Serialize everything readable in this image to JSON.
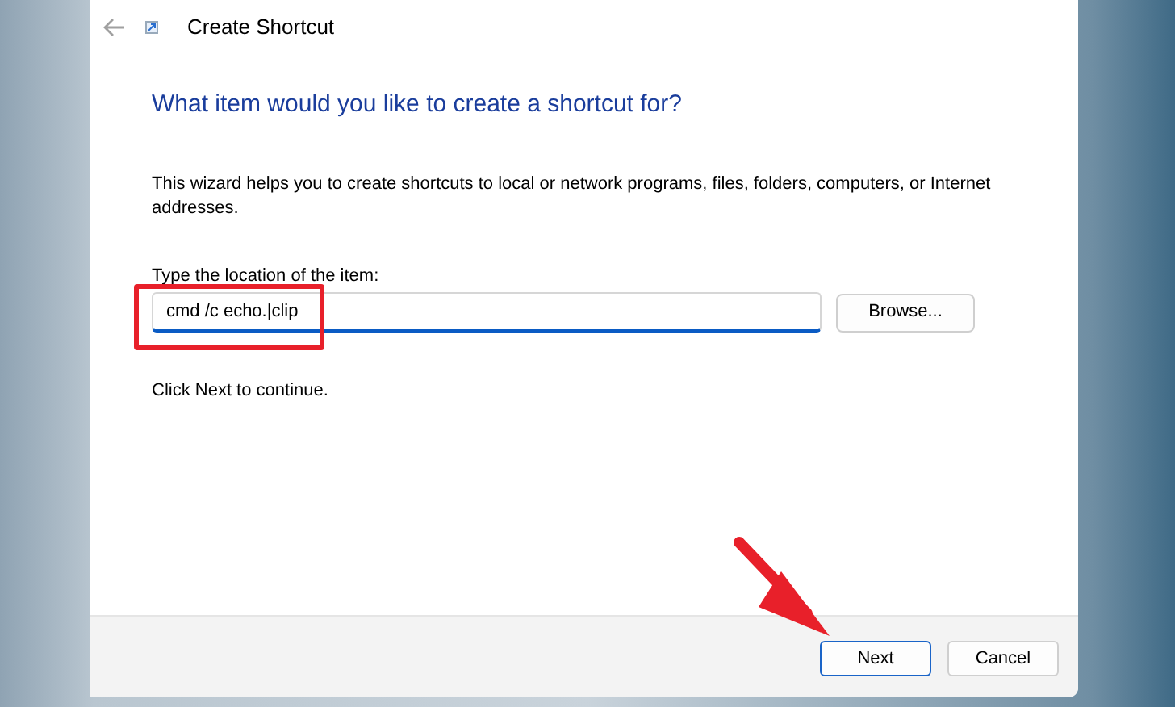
{
  "window": {
    "title": "Create Shortcut"
  },
  "heading": "What item would you like to create a shortcut for?",
  "description": "This wizard helps you to create shortcuts to local or network programs, files, folders, computers, or Internet addresses.",
  "location": {
    "label": "Type the location of the item:",
    "value": "cmd /c echo.|clip",
    "browse": "Browse..."
  },
  "hint": "Click Next to continue.",
  "buttons": [
    {
      "label": "Next",
      "default": true
    },
    {
      "label": "Cancel",
      "default": false
    }
  ]
}
